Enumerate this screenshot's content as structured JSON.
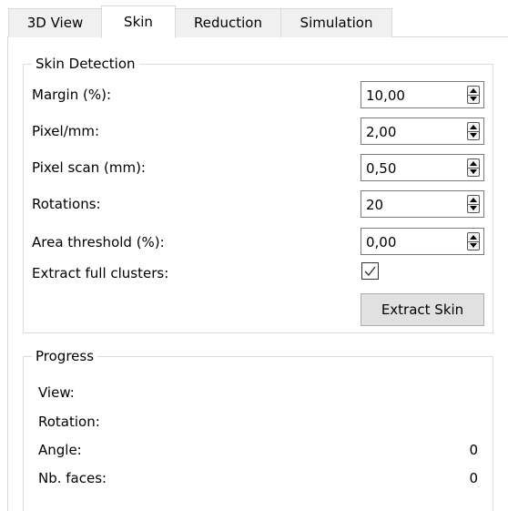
{
  "tabs": [
    {
      "label": "3D View",
      "active": false
    },
    {
      "label": "Skin",
      "active": true
    },
    {
      "label": "Reduction",
      "active": false
    },
    {
      "label": "Simulation",
      "active": false
    }
  ],
  "skin_detection": {
    "title": "Skin Detection",
    "fields": [
      {
        "label": "Margin (%):",
        "value": "10,00"
      },
      {
        "label": "Pixel/mm:",
        "value": "2,00"
      },
      {
        "label": "Pixel scan (mm):",
        "value": "0,50"
      },
      {
        "label": "Rotations:",
        "value": "20"
      },
      {
        "label": "Area threshold (%):",
        "value": "0,00"
      }
    ],
    "extract_full_clusters": {
      "label": "Extract full clusters:",
      "checked": true
    },
    "extract_button": "Extract Skin"
  },
  "progress": {
    "title": "Progress",
    "rows": [
      {
        "label": "View:",
        "value": ""
      },
      {
        "label": "Rotation:",
        "value": ""
      },
      {
        "label": "Angle:",
        "value": "0"
      },
      {
        "label": "Nb. faces:",
        "value": "0"
      }
    ]
  }
}
